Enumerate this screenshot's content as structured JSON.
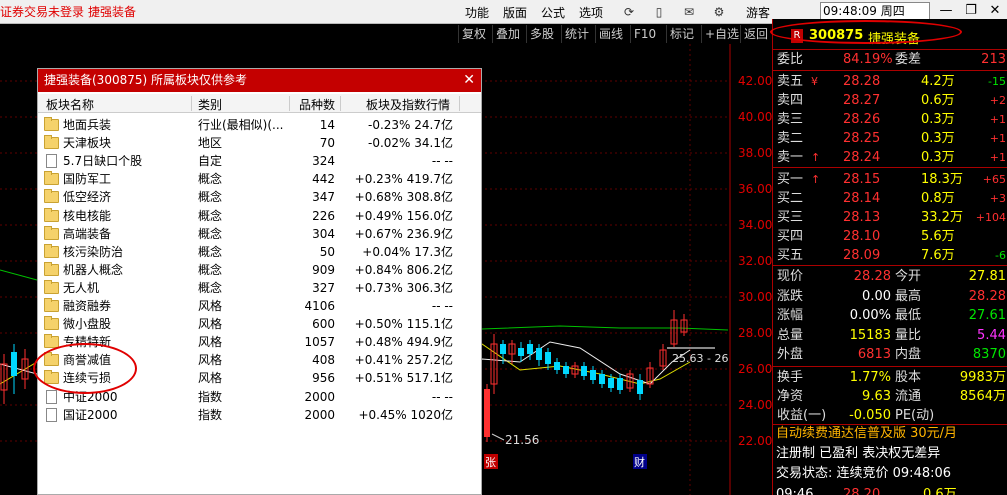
{
  "topbar": {
    "status_text": "证券交易未登录",
    "stock_name": "捷强装备",
    "menus": [
      "功能",
      "版面",
      "公式",
      "选项"
    ],
    "guest": "游客",
    "time": "09:48:09",
    "weekday": "周四"
  },
  "toolbar": {
    "items": [
      "复权",
      "叠加",
      "多股",
      "统计",
      "画线",
      "F10",
      "标记",
      "+自选",
      "返回"
    ]
  },
  "chart": {
    "price_labels": [
      "42.00",
      "40.00",
      "38.00",
      "36.00",
      "34.00",
      "32.00",
      "30.00",
      "28.00",
      "26.00",
      "24.00",
      "22.00"
    ],
    "low_annotation": "21.56",
    "range_annotation": "25.63 - 26",
    "marker_zhang": "张",
    "marker_cai": "财"
  },
  "quote": {
    "badge": "R",
    "code": "300875",
    "name": "捷强装备",
    "weibi_label": "委比",
    "weibi_value": "84.19%",
    "weicha_label": "委差",
    "weicha_value": "213",
    "asks": [
      {
        "label": "卖五",
        "mark": "¥",
        "price": "28.28",
        "vol": "4.2万",
        "chg": "-15"
      },
      {
        "label": "卖四",
        "mark": "",
        "price": "28.27",
        "vol": "0.6万",
        "chg": "+2"
      },
      {
        "label": "卖三",
        "mark": "",
        "price": "28.26",
        "vol": "0.3万",
        "chg": "+1"
      },
      {
        "label": "卖二",
        "mark": "",
        "price": "28.25",
        "vol": "0.3万",
        "chg": "+1"
      },
      {
        "label": "卖一",
        "mark": "↑",
        "price": "28.24",
        "vol": "0.3万",
        "chg": "+1"
      }
    ],
    "bids": [
      {
        "label": "买一",
        "mark": "↑",
        "price": "28.15",
        "vol": "18.3万",
        "chg": "+65"
      },
      {
        "label": "买二",
        "mark": "",
        "price": "28.14",
        "vol": "0.8万",
        "chg": "+3"
      },
      {
        "label": "买三",
        "mark": "",
        "price": "28.13",
        "vol": "33.2万",
        "chg": "+104"
      },
      {
        "label": "买四",
        "mark": "",
        "price": "28.10",
        "vol": "5.6万",
        "chg": ""
      },
      {
        "label": "买五",
        "mark": "",
        "price": "28.09",
        "vol": "7.6万",
        "chg": "-6"
      }
    ],
    "stats1": [
      {
        "l1": "现价",
        "v1": "28.28",
        "l2": "今开",
        "v2": "27.81"
      },
      {
        "l1": "涨跌",
        "v1": "0.00",
        "l2": "最高",
        "v2": "28.28"
      },
      {
        "l1": "涨幅",
        "v1": "0.00%",
        "l2": "最低",
        "v2": "27.61"
      },
      {
        "l1": "总量",
        "v1": "15183",
        "l2": "量比",
        "v2": "5.44"
      },
      {
        "l1": "外盘",
        "v1": "6813",
        "l2": "内盘",
        "v2": "8370"
      }
    ],
    "stats2": [
      {
        "l1": "换手",
        "v1": "1.77%",
        "l2": "股本",
        "v2": "9983万"
      },
      {
        "l1": "净资",
        "v1": "9.63",
        "l2": "流通",
        "v2": "8564万"
      },
      {
        "l1": "收益(一)",
        "v1": "-0.050",
        "l2": "PE(动)",
        "v2": ""
      }
    ],
    "banner": "自动续费通达信普及版 30元/月",
    "note": "注册制 已盈利 表决权无差异",
    "trade_status": "交易状态: 连续竞价 09:48:06",
    "last_time": "09:46",
    "last_price": "28.20",
    "last_vol": "0.6万"
  },
  "dialog": {
    "title": "捷强装备(300875)  所属板块仅供参考",
    "close": "✕",
    "headers": [
      "板块名称",
      "类别",
      "品种数",
      "板块及指数行情"
    ],
    "rows": [
      {
        "icon": "folder",
        "name": "地面兵装",
        "cat": "行业(最相似)(...",
        "count": "14",
        "quote": "-0.23% 24.7亿"
      },
      {
        "icon": "folder",
        "name": "天津板块",
        "cat": "地区",
        "count": "70",
        "quote": "-0.02% 34.1亿"
      },
      {
        "icon": "doc",
        "name": "5.7日缺口个股",
        "cat": "自定",
        "count": "324",
        "quote": "-- --"
      },
      {
        "icon": "folder",
        "name": "国防军工",
        "cat": "概念",
        "count": "442",
        "quote": "+0.23% 419.7亿"
      },
      {
        "icon": "folder",
        "name": "低空经济",
        "cat": "概念",
        "count": "347",
        "quote": "+0.68% 308.8亿"
      },
      {
        "icon": "folder",
        "name": "核电核能",
        "cat": "概念",
        "count": "226",
        "quote": "+0.49% 156.0亿"
      },
      {
        "icon": "folder",
        "name": "高端装备",
        "cat": "概念",
        "count": "304",
        "quote": "+0.67% 236.9亿"
      },
      {
        "icon": "folder",
        "name": "核污染防治",
        "cat": "概念",
        "count": "50",
        "quote": "+0.04% 17.3亿"
      },
      {
        "icon": "folder",
        "name": "机器人概念",
        "cat": "概念",
        "count": "909",
        "quote": "+0.84% 806.2亿"
      },
      {
        "icon": "folder",
        "name": "无人机",
        "cat": "概念",
        "count": "327",
        "quote": "+0.73% 306.3亿"
      },
      {
        "icon": "folder",
        "name": "融资融券",
        "cat": "风格",
        "count": "4106",
        "quote": "-- --"
      },
      {
        "icon": "folder",
        "name": "微小盘股",
        "cat": "风格",
        "count": "600",
        "quote": "+0.50% 115.1亿"
      },
      {
        "icon": "folder",
        "name": "专精特新",
        "cat": "风格",
        "count": "1057",
        "quote": "+0.48% 494.9亿"
      },
      {
        "icon": "folder",
        "name": "商誉减值",
        "cat": "风格",
        "count": "408",
        "quote": "+0.41% 257.2亿"
      },
      {
        "icon": "folder",
        "name": "连续亏损",
        "cat": "风格",
        "count": "956",
        "quote": "+0.51% 517.1亿"
      },
      {
        "icon": "doc",
        "name": "中证2000",
        "cat": "指数",
        "count": "2000",
        "quote": "-- --"
      },
      {
        "icon": "doc",
        "name": "国证2000",
        "cat": "指数",
        "count": "2000",
        "quote": "+0.45% 1020亿"
      }
    ]
  }
}
